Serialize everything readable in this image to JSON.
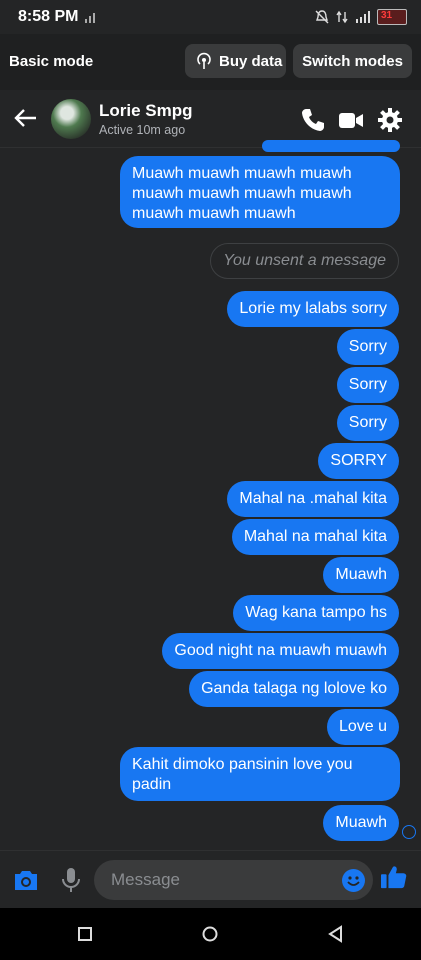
{
  "status_bar": {
    "time": "8:58 PM",
    "battery": "31"
  },
  "mode_bar": {
    "title": "Basic mode",
    "buy_data": "Buy data",
    "switch_modes": "Switch modes"
  },
  "header": {
    "name": "Lorie Smpg",
    "status": "Active 10m ago"
  },
  "messages": {
    "m0": "Muawh muawh muawh muawh muawh muawh muawh muawh muawh muawh muawh",
    "unsent": "You unsent a message",
    "m1": "Lorie my lalabs sorry",
    "m2": "Sorry",
    "m3": "Sorry",
    "m4": "Sorry",
    "m5": "SORRY",
    "m6": "Mahal na .mahal kita",
    "m7": "Mahal na mahal kita",
    "m8": "Muawh",
    "m9": "Wag kana tampo hs",
    "m10": "Good night na muawh muawh",
    "m11": "Ganda talaga ng lolove ko",
    "m12": "Love u",
    "m13": "Kahit dimoko pansinin love you padin",
    "m14": "Muawh"
  },
  "composer": {
    "placeholder": "Message"
  },
  "colors": {
    "bubble": "#1877f2",
    "background": "#242526"
  },
  "icons": [
    "back-arrow-icon",
    "phone-icon",
    "video-icon",
    "settings-gear-icon",
    "camera-icon",
    "microphone-icon",
    "emoji-icon",
    "thumbs-up-icon"
  ]
}
